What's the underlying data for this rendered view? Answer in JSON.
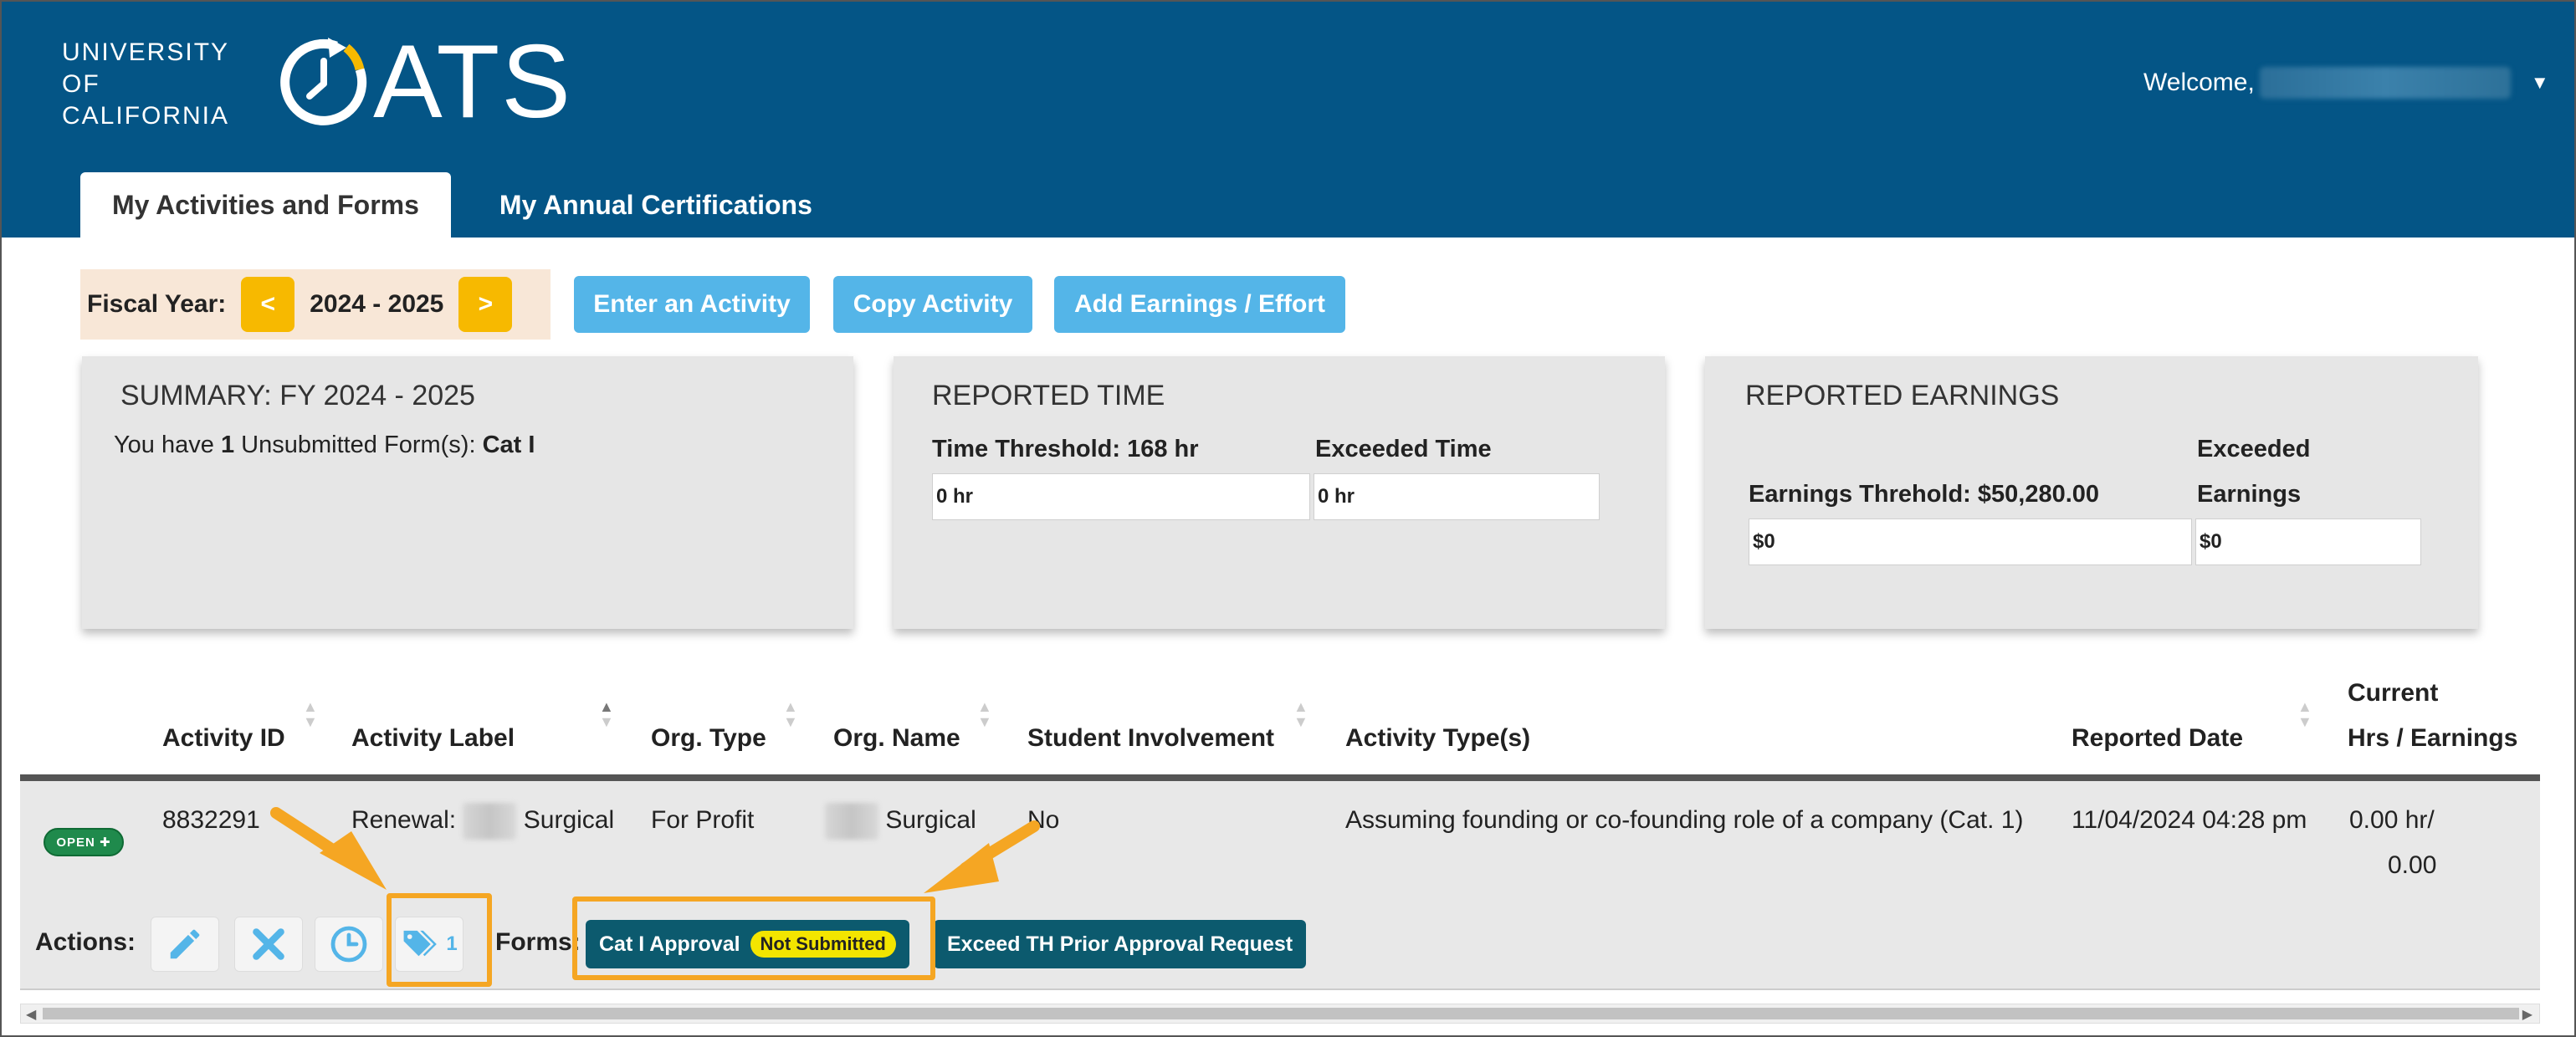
{
  "header": {
    "uc_logo": [
      "UNIVERSITY",
      "OF",
      "CALIFORNIA"
    ],
    "app_name": "ATS",
    "welcome": "Welcome,",
    "brand_color": "#045586",
    "tabs": [
      {
        "label": "My Activities and Forms",
        "active": true
      },
      {
        "label": "My Annual Certifications",
        "active": false
      }
    ]
  },
  "toolbar": {
    "fiscal_year_label": "Fiscal Year:",
    "prev": "<",
    "next": ">",
    "fiscal_year": "2024 - 2025",
    "buttons": [
      "Enter an Activity",
      "Copy Activity",
      "Add Earnings / Effort"
    ]
  },
  "summary": {
    "title": "SUMMARY: FY 2024 - 2025",
    "text_prefix": "You have ",
    "count": "1",
    "text_middle": " Unsubmitted Form(s): ",
    "form_name": "Cat I"
  },
  "reported_time": {
    "title": "REPORTED TIME",
    "threshold_label": "Time Threshold: 168 hr",
    "exceeded_label": "Exceeded Time",
    "threshold_value": "0 hr",
    "exceeded_value": "0 hr"
  },
  "reported_earnings": {
    "title": "REPORTED EARNINGS",
    "threshold_label": "Earnings Threhold: $50,280.00",
    "exceeded_label_1": "Exceeded",
    "exceeded_label_2": "Earnings",
    "threshold_value": "$0",
    "exceeded_value": "$0"
  },
  "table": {
    "columns": [
      "Activity ID",
      "Activity Label",
      "Org. Type",
      "Org. Name",
      "Student Involvement",
      "Activity Type(s)",
      "Reported Date",
      "Current",
      "Hrs / Earnings"
    ],
    "row": {
      "status": "OPEN",
      "activity_id": "8832291",
      "label_prefix": "Renewal:",
      "label_suffix": "Surgical",
      "org_type": "For Profit",
      "org_name_suffix": "Surgical",
      "student_involvement": "No",
      "activity_type": "Assuming founding or co-founding role of a company (Cat. 1)",
      "reported_date": "11/04/2024 04:28 pm",
      "hrs": "0.00 hr/",
      "earnings": "0.00"
    }
  },
  "actions": {
    "label": "Actions:",
    "tag_count": "1",
    "forms_label": "Forms:",
    "forms": [
      {
        "label": "Cat I Approval",
        "badge": "Not Submitted"
      },
      {
        "label": "Exceed TH Prior Approval Request"
      }
    ]
  }
}
